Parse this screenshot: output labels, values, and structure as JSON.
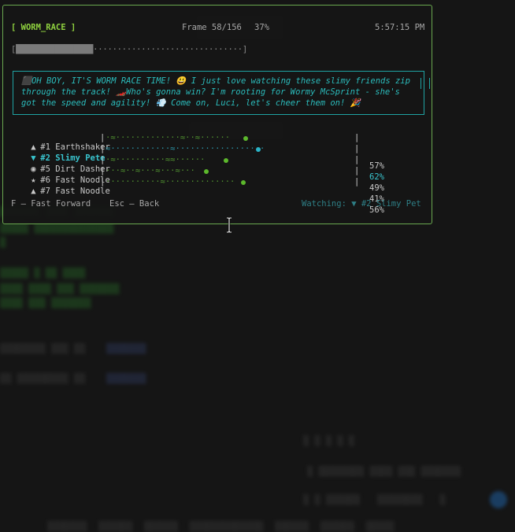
{
  "header": {
    "title": "[ WORM_RACE ]",
    "frame": "Frame 58/156",
    "percent": "37%",
    "clock": "5:57:15 PM"
  },
  "progress": {
    "value": 0.37,
    "open": "[",
    "filled": "████████████████",
    "empty": "·······························",
    "close": "]"
  },
  "banner": {
    "text": "⬛OH BOY, IT'S WORM RACE TIME! 😃 I just love watching these slimy friends zip through the track! 🏎️Who's gonna win? I'm rooting for Wormy McSprint - she's got the speed and agility! 💨 Come on, Luci, let's cheer them on! 🎉"
  },
  "racers": [
    {
      "icon": "▲",
      "name": "#1 Earthshaker",
      "track": "·≈·············≈··≈······",
      "progress": 0.57,
      "pct": "57%",
      "selected": false
    },
    {
      "icon": "▼",
      "name": "#2 Slimy Pete",
      "track": "≈············≈··················",
      "progress": 0.62,
      "pct": "62%",
      "selected": true
    },
    {
      "icon": "◉",
      "name": "#5 Dirt Dasher",
      "track": "·≈··········≈≈······",
      "progress": 0.49,
      "pct": "49%",
      "selected": false
    },
    {
      "icon": "★",
      "name": "#6 Fast Noodle",
      "track": "···≈··≈···≈···≈···",
      "progress": 0.41,
      "pct": "41%",
      "selected": false
    },
    {
      "icon": "▲",
      "name": "#7 Fast Noodle",
      "track": "···········≈··············",
      "progress": 0.56,
      "pct": "56%",
      "selected": false
    }
  ],
  "footer": {
    "fast_forward": "F — Fast Forward",
    "back": "Esc — Back",
    "watching": "Watching: ▼ #2 Slimy Pet"
  },
  "colors": {
    "accent_green": "#8fd13f",
    "border_green": "#6aa84f",
    "banner_cyan": "#1fa3a3",
    "selected_cyan": "#39c5cf"
  }
}
